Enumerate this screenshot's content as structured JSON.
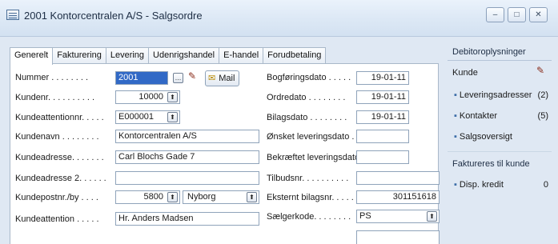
{
  "window": {
    "title": "2001 Kontorcentralen A/S - Salgsordre",
    "icon": "form-icon"
  },
  "tabs": [
    "Generelt",
    "Fakturering",
    "Levering",
    "Udenrigshandel",
    "E-handel",
    "Forudbetaling"
  ],
  "left": {
    "nummer_label": "Nummer . . . . . . . .",
    "nummer_value": "2001",
    "mail_label": "Mail",
    "kundenr_label": "Kundenr. . . . . . . . . .",
    "kundenr_value": "10000",
    "kundeattentionnr_label": "Kundeattentionnr. . . . .",
    "kundeattentionnr_value": "E000001",
    "kundenavn_label": "Kundenavn . . . . . . . .",
    "kundenavn_value": "Kontorcentralen A/S",
    "kundeadresse_label": "Kundeadresse. . . . . . .",
    "kundeadresse_value": "Carl Blochs Gade 7",
    "kundeadresse2_label": "Kundeadresse 2. . . . . .",
    "kundeadresse2_value": "",
    "kundepostnr_label": "Kundepostnr./by . . . .",
    "kundepostnr_value": "5800",
    "kundeby_value": "Nyborg",
    "kundeattention_label": "Kundeattention . . . . .",
    "kundeattention_value": "Hr. Anders Madsen"
  },
  "right": {
    "bogforingsdato_label": "Bogføringsdato . . . . .",
    "bogforingsdato_value": "19-01-11",
    "ordredato_label": "Ordredato . . . . . . . .",
    "ordredato_value": "19-01-11",
    "bilagsdato_label": "Bilagsdato . . . . . . . .",
    "bilagsdato_value": "19-01-11",
    "onsket_label": "Ønsket leveringsdato . .",
    "onsket_value": "",
    "bekraeftet_label": "Bekræftet leveringsdato.",
    "bekraeftet_value": "",
    "tilbudsnr_label": "Tilbudsnr. . . . . . . . . .",
    "tilbudsnr_value": "",
    "eksternt_label": "Eksternt bilagsnr. . . . .",
    "eksternt_value": "301151618",
    "saelgerkode_label": "Sælgerkode. . . . . . . .",
    "saelgerkode_value": "PS"
  },
  "sidebar": {
    "header": "Debitoroplysninger",
    "kunde": "Kunde",
    "items": [
      {
        "label": "Leveringsadresser",
        "count": "(2)"
      },
      {
        "label": "Kontakter",
        "count": "(5)"
      },
      {
        "label": "Salgsoversigt",
        "count": ""
      }
    ],
    "header2": "Faktureres til kunde",
    "disp_label": "Disp. kredit",
    "disp_value": "0"
  }
}
